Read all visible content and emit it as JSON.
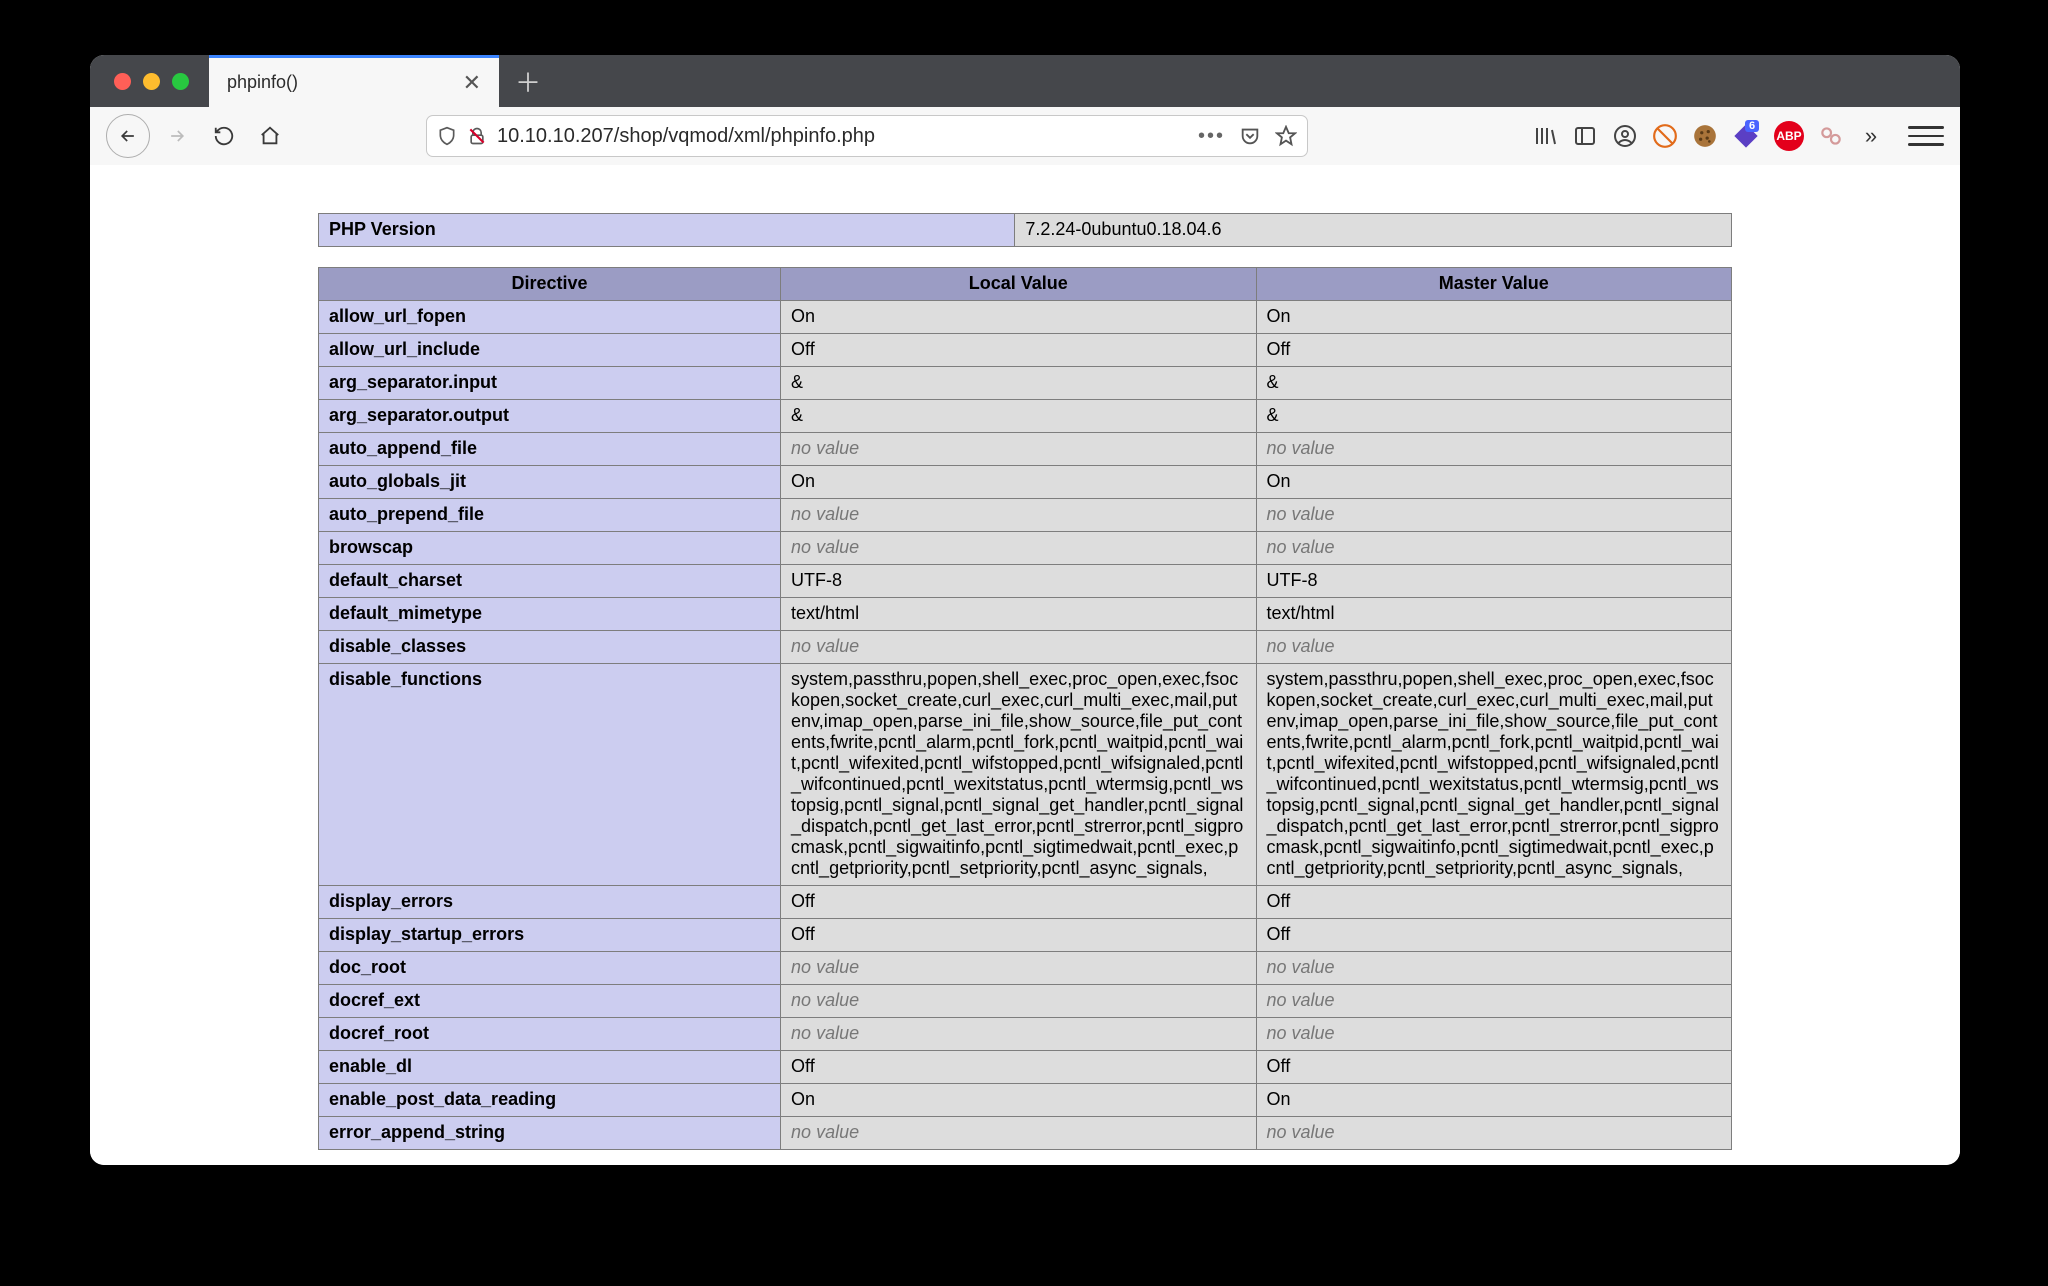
{
  "window": {
    "tab_title": "phpinfo()",
    "url": "10.10.10.207/shop/vqmod/xml/phpinfo.php"
  },
  "ext_badge": "6",
  "abp_label": "ABP",
  "phpinfo": {
    "version_label": "PHP Version",
    "version_value": "7.2.24-0ubuntu0.18.04.6",
    "columns": [
      "Directive",
      "Local Value",
      "Master Value"
    ],
    "no_value_text": "no value",
    "rows": [
      {
        "d": "allow_url_fopen",
        "l": "On",
        "m": "On"
      },
      {
        "d": "allow_url_include",
        "l": "Off",
        "m": "Off"
      },
      {
        "d": "arg_separator.input",
        "l": "&",
        "m": "&"
      },
      {
        "d": "arg_separator.output",
        "l": "&",
        "m": "&"
      },
      {
        "d": "auto_append_file",
        "l": null,
        "m": null
      },
      {
        "d": "auto_globals_jit",
        "l": "On",
        "m": "On"
      },
      {
        "d": "auto_prepend_file",
        "l": null,
        "m": null
      },
      {
        "d": "browscap",
        "l": null,
        "m": null
      },
      {
        "d": "default_charset",
        "l": "UTF-8",
        "m": "UTF-8"
      },
      {
        "d": "default_mimetype",
        "l": "text/html",
        "m": "text/html"
      },
      {
        "d": "disable_classes",
        "l": null,
        "m": null
      },
      {
        "d": "disable_functions",
        "l": "system,passthru,popen,shell_exec,proc_open,exec,fsockopen,socket_create,curl_exec,curl_multi_exec,mail,putenv,imap_open,parse_ini_file,show_source,file_put_contents,fwrite,pcntl_alarm,pcntl_fork,pcntl_waitpid,pcntl_wait,pcntl_wifexited,pcntl_wifstopped,pcntl_wifsignaled,pcntl_wifcontinued,pcntl_wexitstatus,pcntl_wtermsig,pcntl_wstopsig,pcntl_signal,pcntl_signal_get_handler,pcntl_signal_dispatch,pcntl_get_last_error,pcntl_strerror,pcntl_sigprocmask,pcntl_sigwaitinfo,pcntl_sigtimedwait,pcntl_exec,pcntl_getpriority,pcntl_setpriority,pcntl_async_signals,",
        "m": "system,passthru,popen,shell_exec,proc_open,exec,fsockopen,socket_create,curl_exec,curl_multi_exec,mail,putenv,imap_open,parse_ini_file,show_source,file_put_contents,fwrite,pcntl_alarm,pcntl_fork,pcntl_waitpid,pcntl_wait,pcntl_wifexited,pcntl_wifstopped,pcntl_wifsignaled,pcntl_wifcontinued,pcntl_wexitstatus,pcntl_wtermsig,pcntl_wstopsig,pcntl_signal,pcntl_signal_get_handler,pcntl_signal_dispatch,pcntl_get_last_error,pcntl_strerror,pcntl_sigprocmask,pcntl_sigwaitinfo,pcntl_sigtimedwait,pcntl_exec,pcntl_getpriority,pcntl_setpriority,pcntl_async_signals,"
      },
      {
        "d": "display_errors",
        "l": "Off",
        "m": "Off"
      },
      {
        "d": "display_startup_errors",
        "l": "Off",
        "m": "Off"
      },
      {
        "d": "doc_root",
        "l": null,
        "m": null
      },
      {
        "d": "docref_ext",
        "l": null,
        "m": null
      },
      {
        "d": "docref_root",
        "l": null,
        "m": null
      },
      {
        "d": "enable_dl",
        "l": "Off",
        "m": "Off"
      },
      {
        "d": "enable_post_data_reading",
        "l": "On",
        "m": "On"
      },
      {
        "d": "error_append_string",
        "l": null,
        "m": null
      }
    ]
  }
}
